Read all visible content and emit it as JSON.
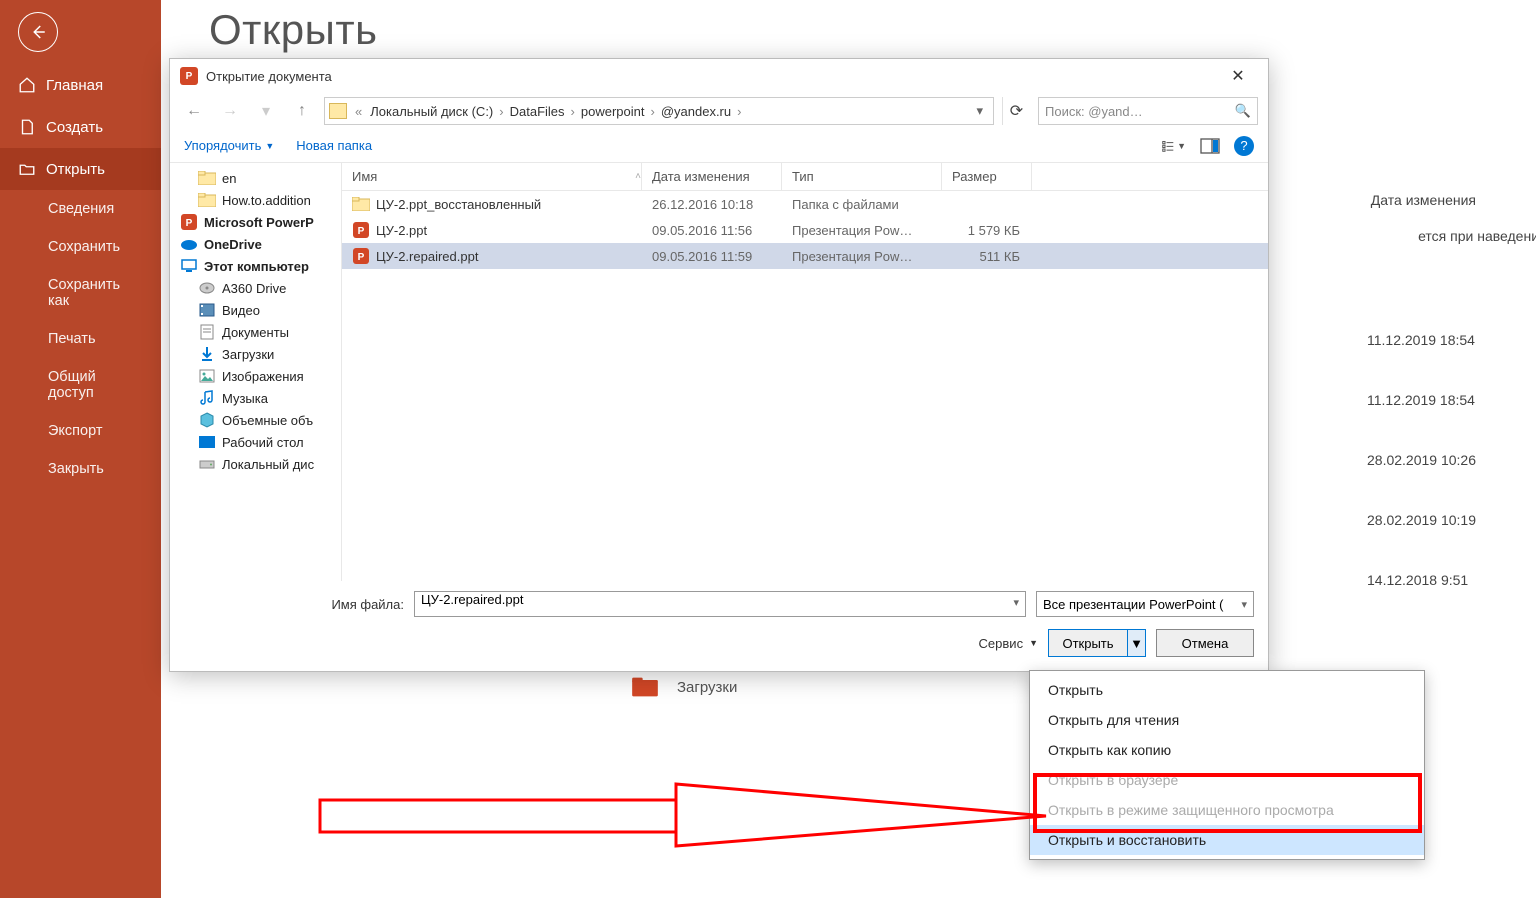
{
  "backstage": {
    "title": "Открыть",
    "nav": {
      "home": "Главная",
      "new": "Создать",
      "open": "Открыть"
    },
    "subs": [
      "Сведения",
      "Сохранить",
      "Сохранить как",
      "Печать",
      "Общий доступ",
      "Экспорт",
      "Закрыть"
    ],
    "dateHeader": "Дата изменения",
    "hint": "ется при наведении указа",
    "dates": [
      "11.12.2019 18:54",
      "11.12.2019 18:54",
      "28.02.2019 10:26",
      "28.02.2019 10:19",
      "14.12.2018 9:51"
    ],
    "downloads": "Загрузки"
  },
  "dialog": {
    "title": "Открытие документа",
    "breadcrumbs": [
      "Локальный диск (C:)",
      "DataFiles",
      "powerpoint",
      "@yandex.ru"
    ],
    "searchPlaceholder": "Поиск:                      @yand…",
    "toolbar": {
      "organize": "Упорядочить",
      "newFolder": "Новая папка"
    },
    "tree": [
      {
        "label": "en",
        "icon": "folder",
        "ind": true
      },
      {
        "label": "How.to.addition",
        "icon": "folder",
        "ind": true
      },
      {
        "label": "Microsoft PowerP",
        "icon": "ppt",
        "bold": true
      },
      {
        "label": "OneDrive",
        "icon": "onedrive",
        "bold": true
      },
      {
        "label": "Этот компьютер",
        "icon": "pc",
        "bold": true
      },
      {
        "label": "A360 Drive",
        "icon": "disk",
        "ind": true
      },
      {
        "label": "Видео",
        "icon": "video",
        "ind": true
      },
      {
        "label": "Документы",
        "icon": "doc",
        "ind": true
      },
      {
        "label": "Загрузки",
        "icon": "down",
        "ind": true
      },
      {
        "label": "Изображения",
        "icon": "img",
        "ind": true
      },
      {
        "label": "Музыка",
        "icon": "music",
        "ind": true
      },
      {
        "label": "Объемные объ",
        "icon": "3d",
        "ind": true
      },
      {
        "label": "Рабочий стол",
        "icon": "desk",
        "ind": true
      },
      {
        "label": "Локальный дис",
        "icon": "drive",
        "ind": true
      }
    ],
    "columns": {
      "name": "Имя",
      "date": "Дата изменения",
      "type": "Тип",
      "size": "Размер"
    },
    "files": [
      {
        "name": "ЦУ-2.ppt_восстановленный",
        "date": "26.12.2016 10:18",
        "type": "Папка с файлами",
        "size": "",
        "icon": "folder",
        "sel": false
      },
      {
        "name": "ЦУ-2.ppt",
        "date": "09.05.2016 11:56",
        "type": "Презентация Pow…",
        "size": "1 579 КБ",
        "icon": "ppt",
        "sel": false
      },
      {
        "name": "ЦУ-2.repaired.ppt",
        "date": "09.05.2016 11:59",
        "type": "Презентация Pow…",
        "size": "511 КБ",
        "icon": "ppt",
        "sel": true
      }
    ],
    "filenameLabel": "Имя файла:",
    "filenameValue": "ЦУ-2.repaired.ppt",
    "filterValue": "Все презентации PowerPoint (",
    "tools": "Сервис",
    "openBtn": "Открыть",
    "cancelBtn": "Отмена"
  },
  "openMenu": [
    {
      "label": "Открыть",
      "state": "normal"
    },
    {
      "label": "Открыть для чтения",
      "state": "normal"
    },
    {
      "label": "Открыть как копию",
      "state": "normal"
    },
    {
      "label": "Открыть в браузере",
      "state": "disabled"
    },
    {
      "label": "Открыть в режиме защищенного просмотра",
      "state": "disabled"
    },
    {
      "label": "Открыть и восстановить",
      "state": "hl"
    }
  ]
}
